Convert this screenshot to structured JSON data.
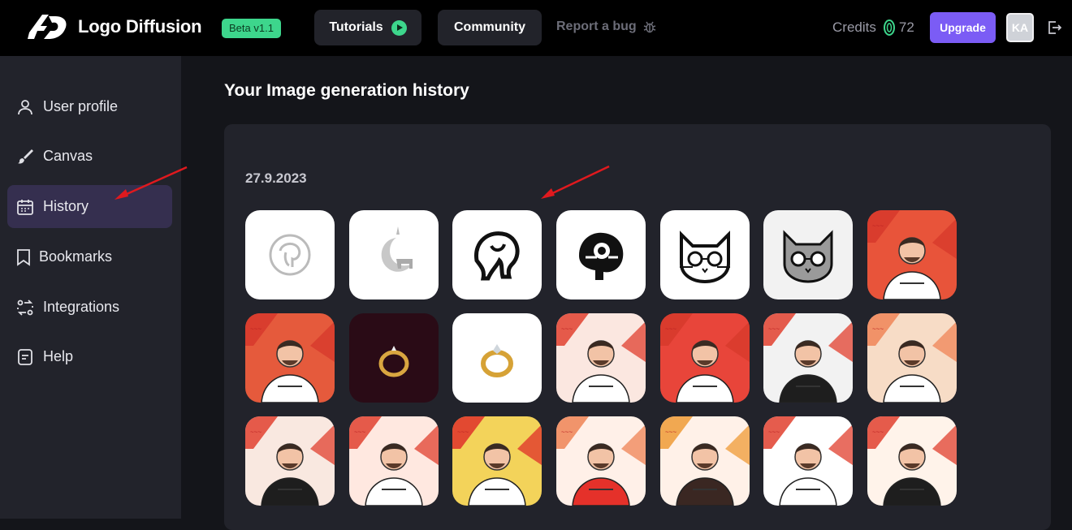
{
  "header": {
    "brand": "Logo Diffusion",
    "beta_badge": "Beta v1.1",
    "tutorials_label": "Tutorials",
    "community_label": "Community",
    "report_bug_label": "Report a bug",
    "credits_label": "Credits",
    "credits_value": "72",
    "upgrade_label": "Upgrade",
    "avatar_initials": "KA",
    "colors": {
      "accent_green": "#3dd68c",
      "upgrade_purple": "#7b5cf5"
    }
  },
  "sidebar": {
    "items": [
      {
        "label": "User profile",
        "icon": "user-icon",
        "active": false
      },
      {
        "label": "Canvas",
        "icon": "brush-icon",
        "active": false
      },
      {
        "label": "History",
        "icon": "calendar-icon",
        "active": true
      },
      {
        "label": "Bookmarks",
        "icon": "bookmark-icon",
        "active": false
      },
      {
        "label": "Integrations",
        "icon": "integrations-icon",
        "active": false
      },
      {
        "label": "Help",
        "icon": "help-doc-icon",
        "active": false
      }
    ]
  },
  "main": {
    "title": "Your Image generation history",
    "groups": [
      {
        "date": "27.9.2023",
        "images": [
          {
            "subject": "elephant-circle-logo",
            "bg": "#ffffff"
          },
          {
            "subject": "elephant-moon-logo",
            "bg": "#ffffff"
          },
          {
            "subject": "elephant-bold-logo",
            "bg": "#ffffff"
          },
          {
            "subject": "elephant-mandala-logo",
            "bg": "#ffffff"
          },
          {
            "subject": "cat-glasses-logo",
            "bg": "#ffffff"
          },
          {
            "subject": "cat-glasses-grey-logo",
            "bg": "#f2f2f2"
          },
          {
            "subject": "man-portrait-red",
            "bg": "#e8543a"
          },
          {
            "subject": "man-portrait-red",
            "bg": "#e55a3c"
          },
          {
            "subject": "gold-ring-dark",
            "bg": "#2a0b16"
          },
          {
            "subject": "gold-ring-white",
            "bg": "#ffffff"
          },
          {
            "subject": "man-portrait-white",
            "bg": "#fbe7e0"
          },
          {
            "subject": "man-portrait-red",
            "bg": "#e8453a"
          },
          {
            "subject": "man-portrait-black-shirt",
            "bg": "#f2f2f2"
          },
          {
            "subject": "man-portrait-peach",
            "bg": "#f7dcc6"
          },
          {
            "subject": "man-portrait-black-shirt",
            "bg": "#f9e8e0"
          },
          {
            "subject": "man-portrait-white",
            "bg": "#ffe8e0"
          },
          {
            "subject": "man-portrait-yellow",
            "bg": "#f3d35a"
          },
          {
            "subject": "man-portrait-red-shirt",
            "bg": "#fff0e8"
          },
          {
            "subject": "man-portrait-dark-shirt",
            "bg": "#fff1e8"
          },
          {
            "subject": "man-portrait-white",
            "bg": "#ffffff"
          },
          {
            "subject": "man-portrait-black-shirt",
            "bg": "#fff3ea"
          }
        ]
      }
    ]
  }
}
